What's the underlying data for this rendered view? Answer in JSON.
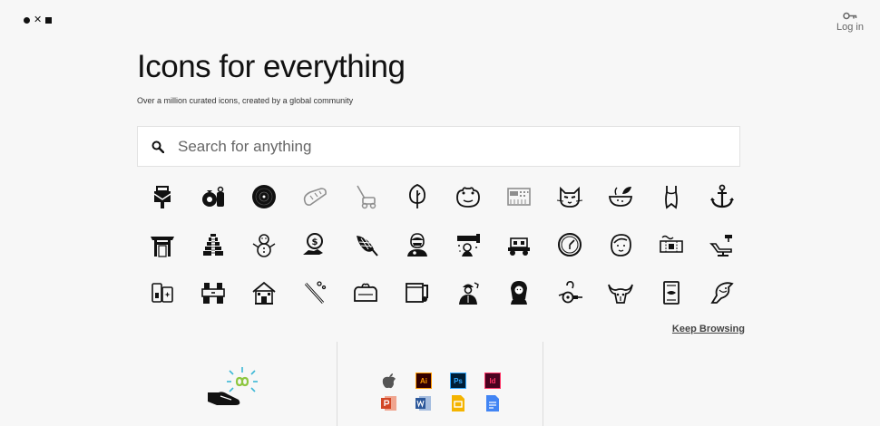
{
  "header": {
    "login_label": "Log in"
  },
  "hero": {
    "title": "Icons for everything",
    "subtitle": "Over a million curated icons, created by a global community"
  },
  "search": {
    "placeholder": "Search for anything"
  },
  "icons": [
    "mailbox-icon",
    "money-bags-icon",
    "vinyl-record-icon",
    "bread-loaf-icon",
    "lawn-mower-icon",
    "tree-icon",
    "frog-icon",
    "synthesizer-icon",
    "cat-face-icon",
    "herbal-tea-icon",
    "swimsuit-icon",
    "anchor-icon",
    "temple-gate-icon",
    "pyramid-icon",
    "snowman-icon",
    "hand-currency-icon",
    "corn-icon",
    "doctor-icon",
    "wizard-scene-icon",
    "farm-tractor-icon",
    "clock-icon",
    "baby-icon",
    "ticket-icon",
    "dentist-chair-icon",
    "devices-icon",
    "kitchen-icon",
    "house-icon",
    "hair-brush-icon",
    "tissue-box-icon",
    "music-note-icon",
    "worker-icon",
    "woman-portrait-icon",
    "rickshaw-icon",
    "bull-skull-icon",
    "book-lips-icon",
    "bird-icon"
  ],
  "keep_browsing": "Keep Browsing",
  "apps": {
    "ai_label": "Ai",
    "ps_label": "Ps",
    "id_label": "Id",
    "colors": {
      "ai": "#ff9a00",
      "ps": "#31a8ff",
      "id": "#ff3366",
      "ppt": "#d24726",
      "word": "#2b579a",
      "slides": "#f4b400",
      "docs": "#4285f4"
    }
  }
}
